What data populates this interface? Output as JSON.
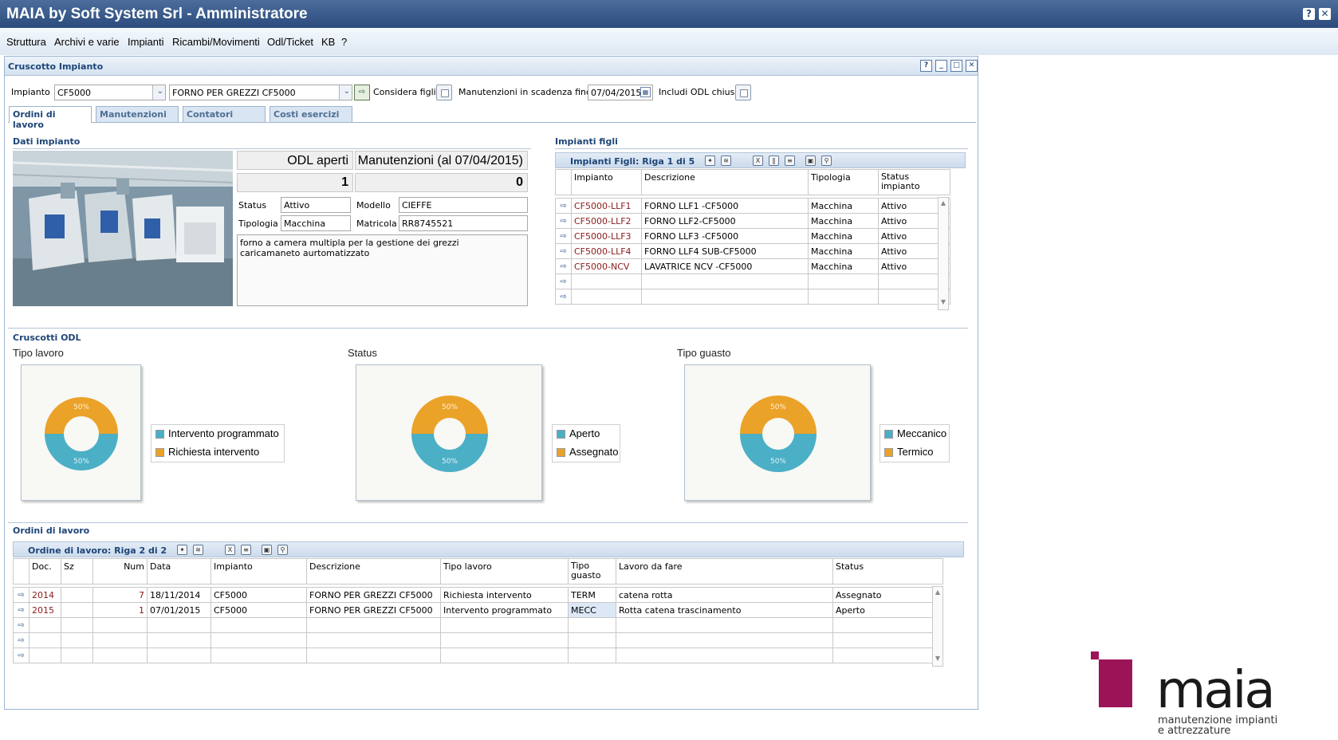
{
  "app": {
    "title": "MAIA by Soft System Srl - Amministratore",
    "help_label": "?",
    "close_label": "✕"
  },
  "menu": [
    "Struttura",
    "Archivi e varie",
    "Impianti",
    "Ricambi/Movimenti",
    "Odl/Ticket",
    "KB",
    "?"
  ],
  "window": {
    "title": "Cruscotto Impianto"
  },
  "filters": {
    "impianto_label": "Impianto",
    "impianto_code": "CF5000",
    "impianto_desc": "FORNO PER GREZZI CF5000",
    "considera_figli_label": "Considera figli",
    "manutenzioni_label": "Manutenzioni in scadenza fino a",
    "date": "07/04/2015",
    "includi_label": "Includi ODL chiusi"
  },
  "tabs": [
    "Ordini di lavoro",
    "Manutenzioni",
    "Contatori",
    "Costi esercizi"
  ],
  "dati": {
    "section": "Dati impianto",
    "odl_label": "ODL aperti",
    "odl_value": "1",
    "man_label": "Manutenzioni (al 07/04/2015)",
    "man_value": "0",
    "status_label": "Status",
    "status": "Attivo",
    "modello_label": "Modello",
    "modello": "CIEFFE",
    "tipologia_label": "Tipologia",
    "tipologia": "Macchina",
    "matricola_label": "Matricola",
    "matricola": "RR8745521",
    "note": [
      "forno a camera multipla per la gestione dei grezzi",
      "caricamaneto aurtomatizzato"
    ]
  },
  "figli": {
    "section": "Impianti figli",
    "bar": "Impianti Figli: Riga 1 di 5",
    "headers": [
      "Impianto",
      "Descrizione",
      "Tipologia",
      "Status impianto"
    ],
    "rows": [
      [
        "CF5000-LLF1",
        "FORNO LLF1 -CF5000",
        "Macchina",
        "Attivo"
      ],
      [
        "CF5000-LLF2",
        "FORNO LLF2-CF5000",
        "Macchina",
        "Attivo"
      ],
      [
        "CF5000-LLF3",
        "FORNO LLF3 -CF5000",
        "Macchina",
        "Attivo"
      ],
      [
        "CF5000-LLF4",
        "FORNO LLF4 SUB-CF5000",
        "Macchina",
        "Attivo"
      ],
      [
        "CF5000-NCV",
        "LAVATRICE NCV -CF5000",
        "Macchina",
        "Attivo"
      ],
      [
        "",
        "",
        "",
        ""
      ],
      [
        "",
        "",
        "",
        ""
      ]
    ]
  },
  "cruscotti": {
    "section": "Cruscotti ODL",
    "colors": {
      "teal": "#4bafc6",
      "orange": "#eba228"
    }
  },
  "chart_data": [
    {
      "type": "pie",
      "title": "Tipo lavoro",
      "labels": [
        "Intervento programmato",
        "Richiesta intervento"
      ],
      "values": [
        50,
        50
      ],
      "value_labels": [
        "50%",
        "50%"
      ]
    },
    {
      "type": "pie",
      "title": "Status",
      "labels": [
        "Aperto",
        "Assegnato"
      ],
      "values": [
        50,
        50
      ],
      "value_labels": [
        "50%",
        "50%"
      ]
    },
    {
      "type": "pie",
      "title": "Tipo guasto",
      "labels": [
        "Meccanico",
        "Termico"
      ],
      "values": [
        50,
        50
      ],
      "value_labels": [
        "50%",
        "50%"
      ]
    }
  ],
  "ordini": {
    "section": "Ordini di lavoro",
    "bar": "Ordine di lavoro: Riga 2 di 2",
    "headers": [
      "Doc.",
      "Sz",
      "Num",
      "Data",
      "Impianto",
      "Descrizione",
      "Tipo lavoro",
      "Tipo guasto",
      "Lavoro da fare",
      "Status"
    ],
    "rows": [
      [
        "2014",
        "",
        "7",
        "18/11/2014",
        "CF5000",
        "FORNO PER GREZZI CF5000",
        "Richiesta intervento",
        "TERM",
        "catena rotta",
        "Assegnato"
      ],
      [
        "2015",
        "",
        "1",
        "07/01/2015",
        "CF5000",
        "FORNO PER GREZZI CF5000",
        "Intervento programmato",
        "MECC",
        "Rotta catena trascinamento",
        "Aperto"
      ],
      [
        "",
        "",
        "",
        "",
        "",
        "",
        "",
        "",
        "",
        ""
      ],
      [
        "",
        "",
        "",
        "",
        "",
        "",
        "",
        "",
        "",
        ""
      ],
      [
        "",
        "",
        "",
        "",
        "",
        "",
        "",
        "",
        "",
        ""
      ]
    ]
  },
  "logo": {
    "tagline1": "manutenzione impianti",
    "tagline2": "e attrezzature"
  }
}
